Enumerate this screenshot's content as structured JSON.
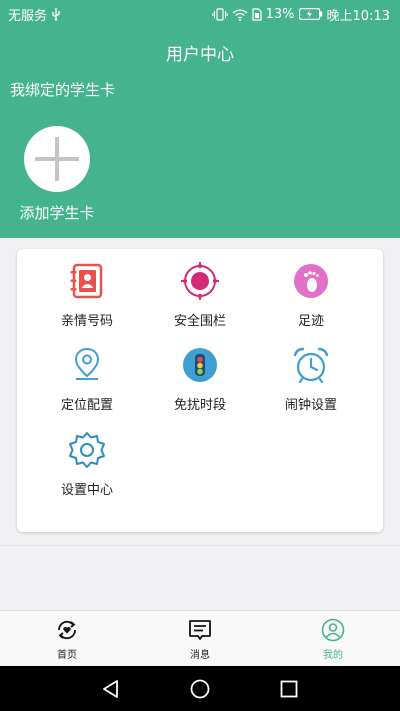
{
  "status_bar": {
    "carrier": "无服务",
    "battery_percent": "13%",
    "time": "晚上10:13"
  },
  "header": {
    "title": "用户中心",
    "subtitle": "我绑定的学生卡",
    "add_card_label": "添加学生卡"
  },
  "grid": {
    "items": [
      {
        "label": "亲情号码",
        "icon": "contacts-book-icon"
      },
      {
        "label": "安全围栏",
        "icon": "geofence-target-icon"
      },
      {
        "label": "足迹",
        "icon": "footprint-icon"
      },
      {
        "label": "定位配置",
        "icon": "location-pin-icon"
      },
      {
        "label": "免扰时段",
        "icon": "traffic-light-icon"
      },
      {
        "label": "闹钟设置",
        "icon": "alarm-clock-icon"
      },
      {
        "label": "设置中心",
        "icon": "gear-icon"
      }
    ]
  },
  "tabbar": {
    "tabs": [
      {
        "label": "首页",
        "icon": "home-refresh-icon"
      },
      {
        "label": "消息",
        "icon": "message-icon"
      },
      {
        "label": "我的",
        "icon": "profile-icon",
        "active": true
      }
    ]
  },
  "colors": {
    "primary": "#45b38e",
    "contacts": "#e8524a",
    "fence": "#d42a78",
    "footprint": "#e070c8",
    "blue": "#3f9fd0"
  }
}
